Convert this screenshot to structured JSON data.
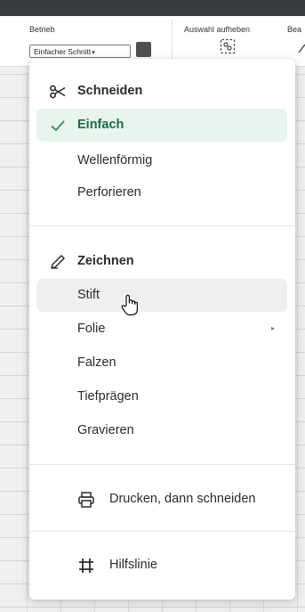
{
  "toolbar": {
    "operation_label": "Betrieb",
    "operation_value": "Einfacher Schnitt",
    "operation_caret": "▾",
    "deselect_label": "Auswahl aufheben",
    "edit_label": "Bea",
    "swatch_color": "#4f4f4f"
  },
  "menu": {
    "cut_header": "Schneiden",
    "cut_items": [
      "Einfach",
      "Wellenförmig",
      "Perforieren"
    ],
    "active_item": "Einfach",
    "draw_header": "Zeichnen",
    "draw_items": [
      "Stift",
      "Folie",
      "Falzen",
      "Tiefprägen",
      "Gravieren"
    ],
    "hovered_item": "Stift",
    "print_then_cut": "Drucken, dann schneiden",
    "guide_line": "Hilfslinie",
    "submenu_arrow": "▸"
  },
  "colors": {
    "active_bg": "#e8f4ee",
    "active_text": "#1d6b47",
    "topbar": "#363c40"
  },
  "icons": [
    "scissors-icon",
    "check-icon",
    "pen-icon",
    "printer-icon",
    "guide-hash-icon",
    "select-off-icon",
    "hand-cursor-icon"
  ]
}
